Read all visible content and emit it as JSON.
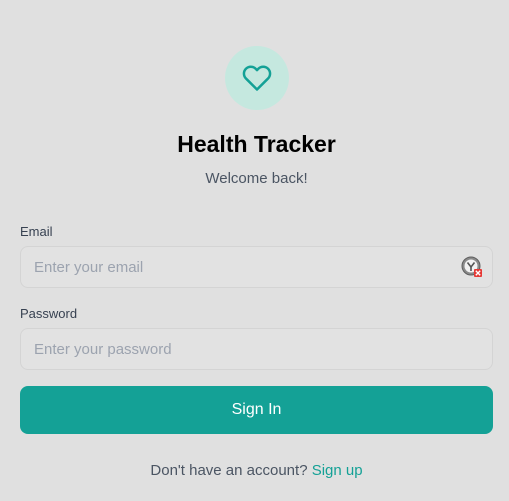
{
  "app": {
    "title": "Health Tracker",
    "subtitle": "Welcome back!",
    "logo_icon": "heart-icon",
    "accent_color": "#14a196",
    "logo_bg_color": "#c5e8df"
  },
  "form": {
    "email": {
      "label": "Email",
      "value": "",
      "placeholder": "Enter your email",
      "extension_icon": "password-manager-icon"
    },
    "password": {
      "label": "Password",
      "value": "",
      "placeholder": "Enter your password"
    },
    "submit_label": "Sign In"
  },
  "footer": {
    "prompt": "Don't have an account?",
    "link_label": "Sign up"
  }
}
